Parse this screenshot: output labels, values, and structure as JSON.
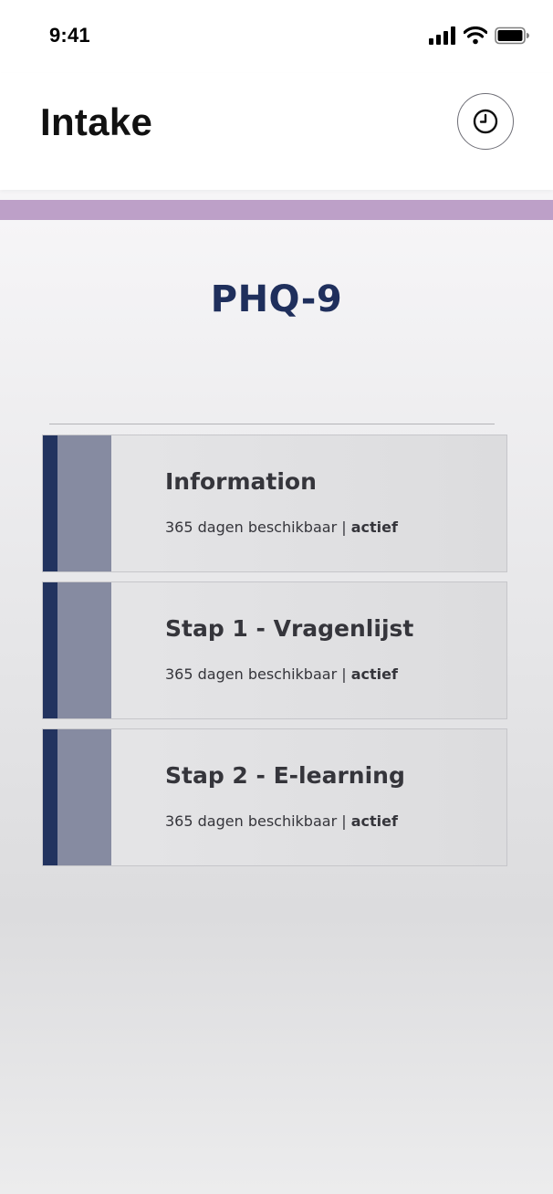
{
  "status_bar": {
    "time": "9:41",
    "icons": [
      "signal-icon",
      "wifi-icon",
      "battery-icon"
    ]
  },
  "header": {
    "title": "Intake",
    "history_icon": "clock-icon"
  },
  "module": {
    "title": "PHQ-9"
  },
  "steps": [
    {
      "title": "Information",
      "availability": "365 dagen beschikbaar",
      "separator": "|",
      "status": "actief"
    },
    {
      "title": "Stap 1 - Vragenlijst",
      "availability": "365 dagen beschikbaar",
      "separator": "|",
      "status": "actief"
    },
    {
      "title": "Stap 2 - E-learning",
      "availability": "365 dagen beschikbaar",
      "separator": "|",
      "status": "actief"
    }
  ],
  "colors": {
    "accent_band": "#bda0c8",
    "navy": "#22335f",
    "thumb_slate": "#868ba1",
    "title_navy": "#1f2f5c"
  }
}
